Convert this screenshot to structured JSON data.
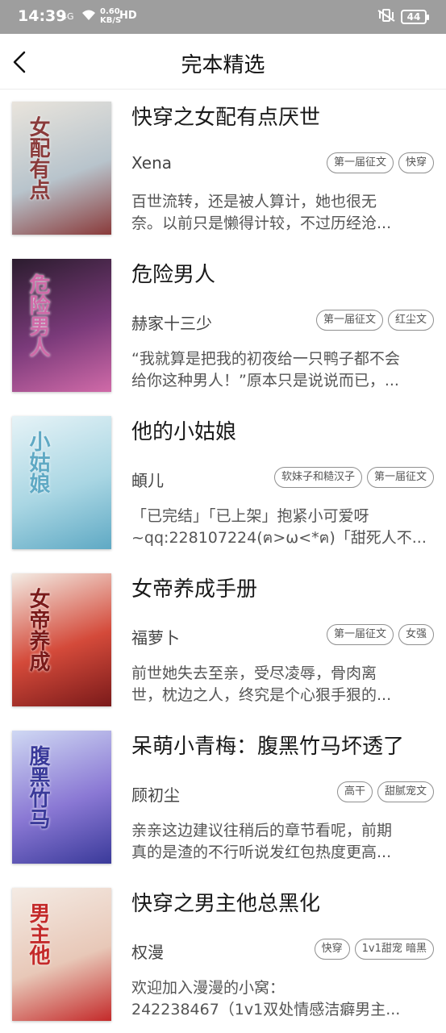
{
  "status_bar": {
    "time": "14:39",
    "signal": "4G",
    "speed": "0.60\nKB/S",
    "speed_top": "0.60",
    "speed_bottom": "KB/S",
    "hd": "HD",
    "battery": "44"
  },
  "header": {
    "title": "完本精选"
  },
  "books": [
    {
      "title": "快穿之女配有点厌世",
      "author": "Xena",
      "tags": [
        "第一届征文",
        "快穿"
      ],
      "desc_line1": "百世流转，还是被人算计，她也很无",
      "desc_line2": "奈。以前只是懒得计较，不过历经沧...",
      "cover_colors": [
        "#e9e4dc",
        "#b8c4cc",
        "#8a3a3a"
      ],
      "cover_text": "女配有点"
    },
    {
      "title": "危险男人",
      "author": "赫家十三少",
      "tags": [
        "第一届征文",
        "红尘文"
      ],
      "desc_line1": "“我就算是把我的初夜给一只鸭子都不会",
      "desc_line2": "给你这种男人！”原本只是说说而已，...",
      "cover_colors": [
        "#2b1c2e",
        "#7a3a7a",
        "#d06aa8"
      ],
      "cover_text": "危险男人"
    },
    {
      "title": "他的小姑娘",
      "author": "頔儿",
      "tags": [
        "软妹子和糙汉子",
        "第一届征文"
      ],
      "desc_line1": "「已完结」「已上架」抱紧小可爱呀",
      "desc_line2": "~qq:228107224(ฅ>ω<*ฅ)「甜死人不...",
      "cover_colors": [
        "#e6f3f7",
        "#a9d6e3",
        "#5fa9c4"
      ],
      "cover_text": "小姑娘"
    },
    {
      "title": "女帝养成手册",
      "author": "福萝卜",
      "tags": [
        "第一届征文",
        "女强"
      ],
      "desc_line1": "前世她失去至亲，受尽凌辱，骨肉离",
      "desc_line2": "世，枕边之人，终究是个心狠手狠的...",
      "cover_colors": [
        "#f3ece4",
        "#d44a3a",
        "#7a1a1a"
      ],
      "cover_text": "女帝养成"
    },
    {
      "title": "呆萌小青梅：腹黑竹马坏透了",
      "author": "顾初尘",
      "tags": [
        "高干",
        "甜腻宠文"
      ],
      "desc_line1": "亲亲这边建议往稍后的章节看呢，前期",
      "desc_line2": "真的是渣的不行听说发红包热度更高...",
      "cover_colors": [
        "#cfd8f3",
        "#8a78d4",
        "#3a3a9a"
      ],
      "cover_text": "腹黑竹马"
    },
    {
      "title": "快穿之男主他总黑化",
      "author": "权漫",
      "tags": [
        "快穿",
        "1v1甜宠 暗黑"
      ],
      "desc_line1": "欢迎加入漫漫的小窝：",
      "desc_line2": "242238467（1v1双处情感洁癖男主...",
      "cover_colors": [
        "#f4ebe4",
        "#e8c8b8",
        "#c42a2a"
      ],
      "cover_text": "男主他"
    }
  ]
}
